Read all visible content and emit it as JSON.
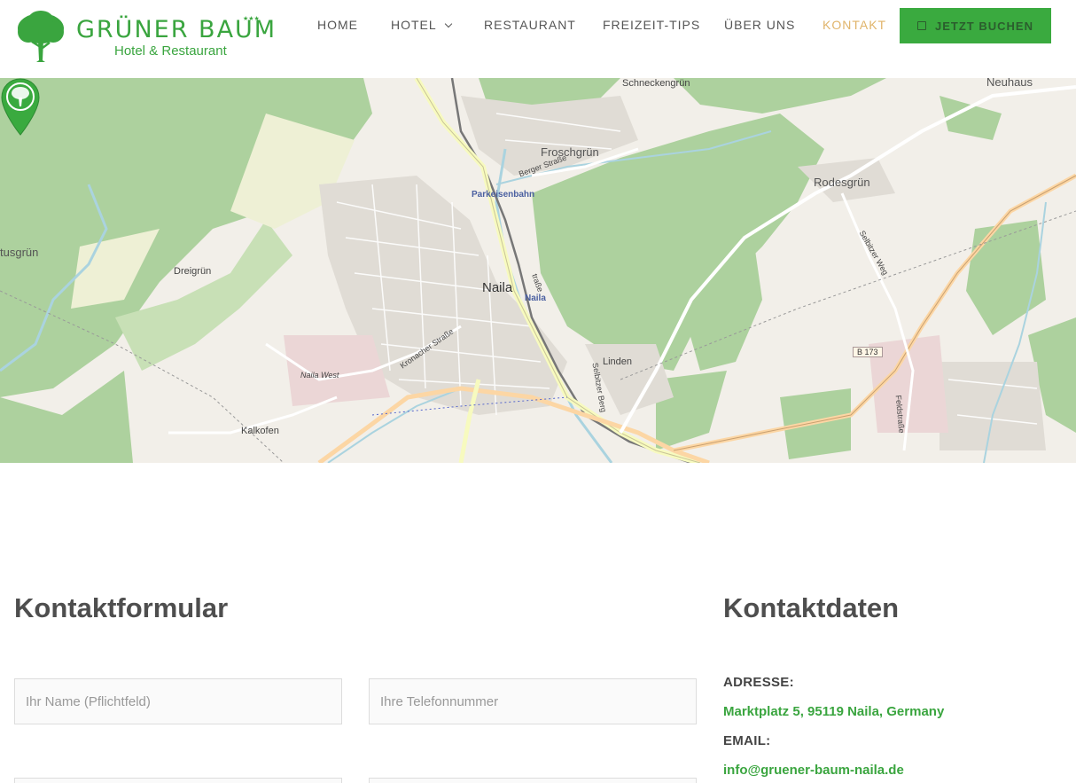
{
  "header": {
    "logo": {
      "title": "GRÜNER BAUM",
      "subtitle": "Hotel & Restaurant",
      "stars": "★★★"
    },
    "nav": [
      {
        "label": "HOME",
        "active": false
      },
      {
        "label": "HOTEL",
        "active": false,
        "has_dropdown": true
      },
      {
        "label": "RESTAURANT",
        "active": false
      },
      {
        "label": "FREIZEIT-TIPS",
        "active": false
      },
      {
        "label": "ÜBER UNS",
        "active": false
      },
      {
        "label": "KONTAKT",
        "active": true
      }
    ],
    "book_button": "JETZT BUCHEN"
  },
  "map": {
    "labels": {
      "naila": "Naila",
      "froschgruen": "Froschgrün",
      "schneckengruen": "Schneckengrün",
      "neuhaus": "Neuhaus",
      "rodesgruen": "Rodesgrün",
      "dreigruen": "Dreigrün",
      "tusgruen": "tusgrün",
      "kalkofen": "Kalkofen",
      "linden": "Linden",
      "naila_west": "Naila West",
      "parkeisenbahn": "Parkeisenbahn",
      "naila_station": "Naila",
      "berger_strasse": "Berger Straße",
      "kronacher_strasse": "Kronacher Straße",
      "selbitzer_weg": "Selbitzer Weg",
      "feldstrasse": "Feldstraße",
      "b173": "B 173",
      "strasse": "traße",
      "selbitzer_berg": "Selbitzer Berg"
    }
  },
  "contact_form": {
    "heading": "Kontaktformular",
    "name_placeholder": "Ihr Name (Pflichtfeld)",
    "phone_placeholder": "Ihre Telefonnummer"
  },
  "contact_info": {
    "heading": "Kontaktdaten",
    "address_label": "ADRESSE:",
    "address_value": "Marktplatz 5, 95119 Naila, Germany",
    "email_label": "EMAIL:",
    "email_value": "info@gruener-baum-naila.de"
  },
  "colors": {
    "brand_green": "#3aa53f",
    "nav_active": "#e0b46a",
    "heading": "#4e4e4e"
  }
}
